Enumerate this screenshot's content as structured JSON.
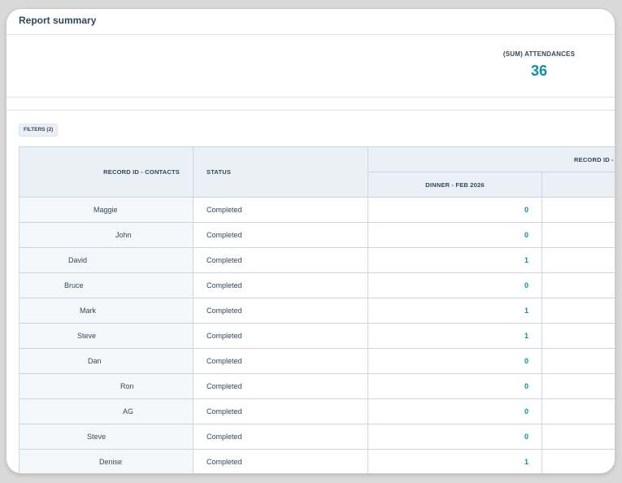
{
  "header": {
    "title": "Report summary"
  },
  "kpi": {
    "label": "(SUM) ATTENDANCES",
    "value": "36"
  },
  "filters": {
    "label": "FILTERS (2)"
  },
  "table": {
    "headers": {
      "record_id_contacts": "RECORD ID - CONTACTS",
      "status": "STATUS",
      "group": "RECORD ID -",
      "dinner": "DINNER - FEB 2026"
    },
    "rows": [
      {
        "name": "Maggie",
        "status": "Completed",
        "dinner": "0"
      },
      {
        "name": "John",
        "status": "Completed",
        "dinner": "0"
      },
      {
        "name": "David",
        "status": "Completed",
        "dinner": "1"
      },
      {
        "name": "Bruce",
        "status": "Completed",
        "dinner": "0"
      },
      {
        "name": "Mark",
        "status": "Completed",
        "dinner": "1"
      },
      {
        "name": "Steve",
        "status": "Completed",
        "dinner": "1"
      },
      {
        "name": "Dan",
        "status": "Completed",
        "dinner": "0"
      },
      {
        "name": "Ron",
        "status": "Completed",
        "dinner": "0"
      },
      {
        "name": "AG",
        "status": "Completed",
        "dinner": "0"
      },
      {
        "name": "Steve",
        "status": "Completed",
        "dinner": "0"
      },
      {
        "name": "Denise",
        "status": "Completed",
        "dinner": "1"
      }
    ]
  }
}
